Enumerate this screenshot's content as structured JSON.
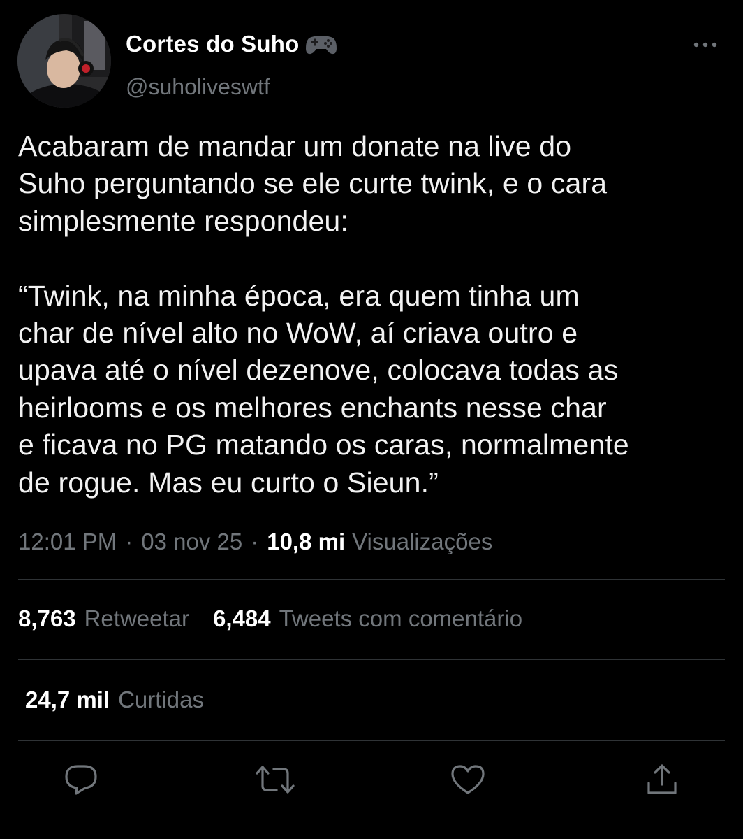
{
  "author": {
    "display_name": "Cortes do Suho",
    "badge_icon": "gamepad-icon",
    "handle": "@suholiveswtf"
  },
  "tweet": {
    "text": "Acabaram de mandar um donate na live do\nSuho perguntando se ele curte twink, e o cara\nsimplesmente respondeu:\n\n“Twink, na minha época, era quem tinha um\nchar de nível alto no WoW, aí criava outro e\nupava até o nível dezenove, colocava todas as\nheirlooms e os melhores enchants nesse char\ne ficava no PG matando os caras, normalmente\nde rogue. Mas eu curto o Sieun.”"
  },
  "meta": {
    "time": "12:01 PM",
    "separator": "·",
    "date": "03 nov 25",
    "views_count": "10,8 mi",
    "views_label": "Visualizações"
  },
  "stats": {
    "retweets_count": "8,763",
    "retweets_label": "Retweetar",
    "quotes_count": "6,484",
    "quotes_label": "Tweets com comentário",
    "likes_count": "24,7 mil",
    "likes_label": "Curtidas"
  },
  "actions": {
    "reply_icon": "reply-icon",
    "retweet_icon": "retweet-icon",
    "like_icon": "heart-icon",
    "share_icon": "share-icon"
  },
  "colors": {
    "background": "#000000",
    "text_primary": "#e7e9ea",
    "text_secondary": "#71767b",
    "divider": "#2f3336"
  }
}
